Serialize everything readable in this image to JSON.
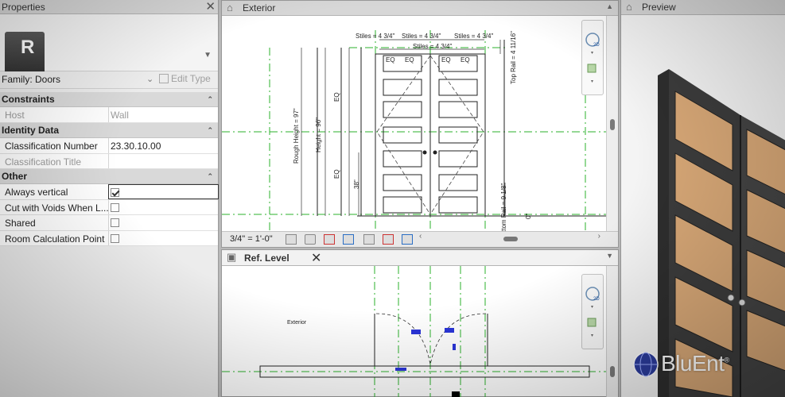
{
  "properties": {
    "title": "Properties",
    "logo_letter": "R",
    "family_label": "Family: Doors",
    "edit_type_label": "Edit Type",
    "groups": [
      {
        "name": "Constraints",
        "rows": [
          {
            "name": "Host",
            "value": "Wall",
            "dim": true
          }
        ]
      },
      {
        "name": "Identity Data",
        "rows": [
          {
            "name": "Classification Number",
            "value": "23.30.10.00",
            "dim": false
          },
          {
            "name": "Classification Title",
            "value": "",
            "dim": true
          }
        ]
      },
      {
        "name": "Other",
        "rows": [
          {
            "name": "Always vertical",
            "checked": true
          },
          {
            "name": "Cut with Voids When L...",
            "checked": false
          },
          {
            "name": "Shared",
            "checked": false
          },
          {
            "name": "Room Calculation Point",
            "checked": false
          }
        ]
      }
    ]
  },
  "exterior_view": {
    "title": "Exterior",
    "scale": "3/4\" = 1'-0\"",
    "dimensions": {
      "stiles_left": "Stiles = 4 3/4\"",
      "stiles_mid": "Stiles = 4 3/4\"",
      "stiles_right": "Stiles = 4 3/4\"",
      "stiles_center": "Stiles = 4 3/4\"",
      "eq": "EQ",
      "top_rail": "Top Rail = 4 11/16\"",
      "bottom_rail": "ttom Rail = 9 1/8\"",
      "rough_height": "Rough Height = 97\"",
      "height": "Height = 96\"",
      "height_38": "38\"",
      "zero": "0\""
    }
  },
  "ref_level_view": {
    "title": "Ref. Level",
    "exterior_label": "Exterior"
  },
  "preview": {
    "title": "Preview"
  },
  "brand": {
    "wordmark": "BluEnt",
    "registered": "®"
  },
  "colors": {
    "ref_plane_green": "#2bb02b",
    "dim_blue": "#2a35d8",
    "door_wood": "#d8a877",
    "door_frame": "#3a3a3a"
  }
}
